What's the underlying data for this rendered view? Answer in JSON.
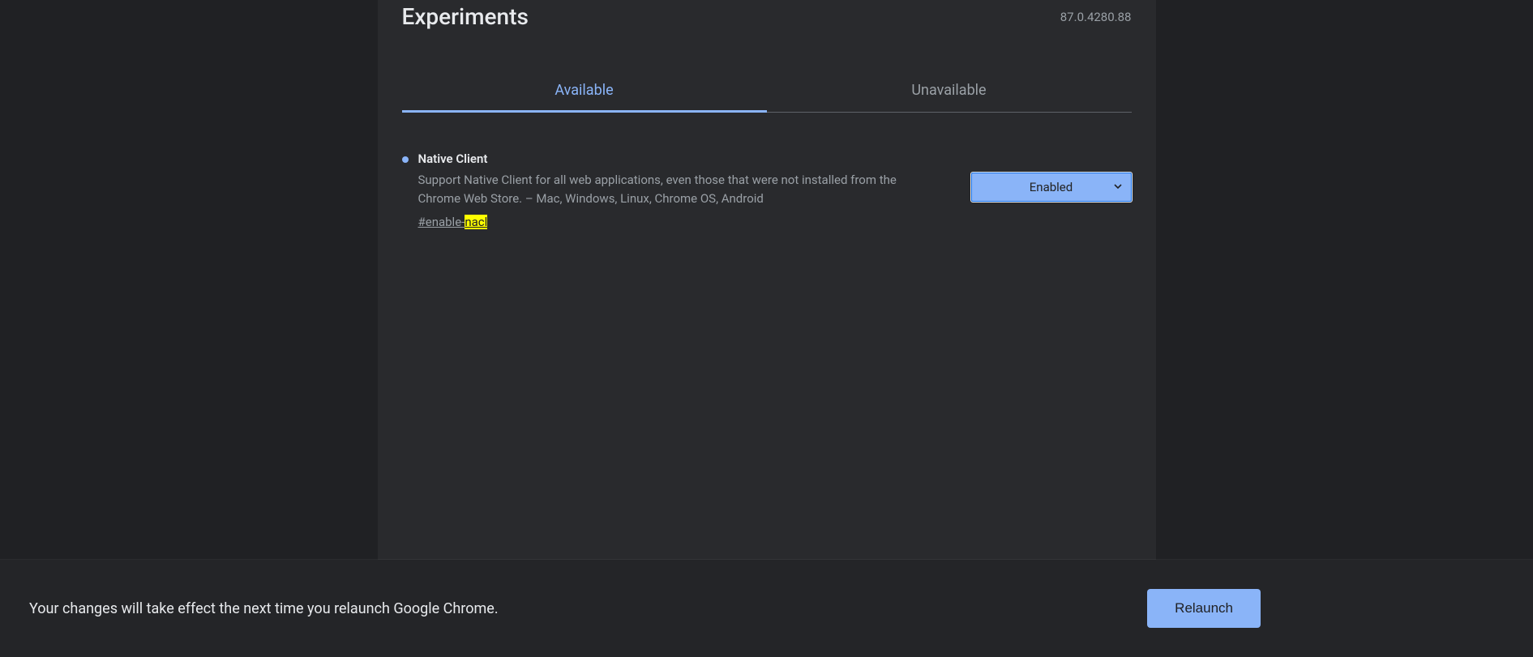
{
  "header": {
    "title": "Experiments",
    "version": "87.0.4280.88"
  },
  "tabs": {
    "available": "Available",
    "unavailable": "Unavailable"
  },
  "experiment": {
    "title": "Native Client",
    "description": "Support Native Client for all web applications, even those that were not installed from the Chrome Web Store. – Mac, Windows, Linux, Chrome OS, Android",
    "hash_prefix": "#enable-",
    "hash_highlight": "nacl",
    "selected": "Enabled"
  },
  "restart": {
    "message": "Your changes will take effect the next time you relaunch Google Chrome.",
    "button": "Relaunch"
  }
}
